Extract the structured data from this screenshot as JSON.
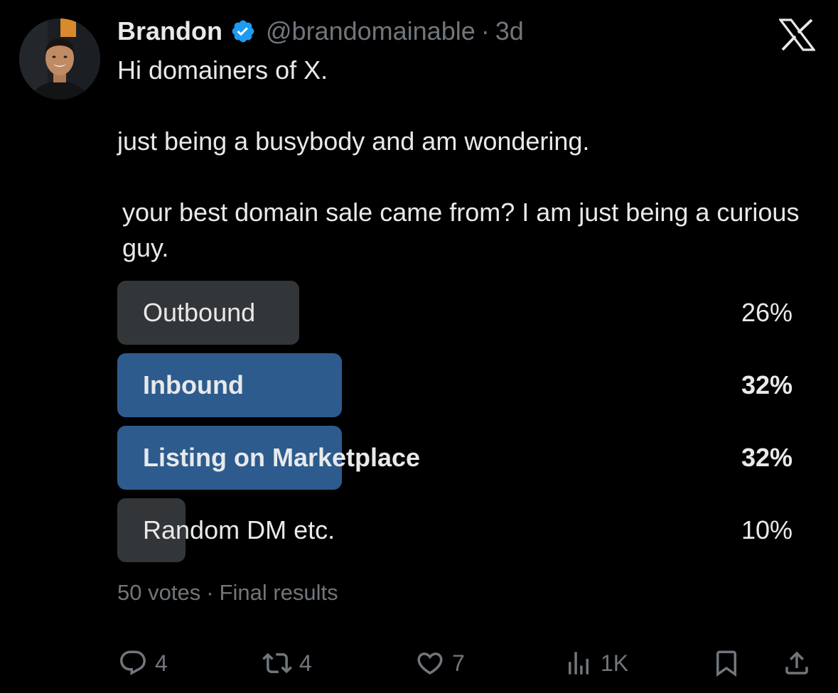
{
  "post": {
    "author": {
      "name": "Brandon",
      "handle": "@brandomainable",
      "verified": true,
      "verified_color": "#1d9bf0"
    },
    "separator": "·",
    "age": "3d",
    "text": {
      "line1": "Hi domainers of X.",
      "line2": "just being a busybody and am wondering.",
      "line3": "your best domain sale came from? I am just being a curious guy."
    }
  },
  "platform": {
    "logo": "x-logo"
  },
  "poll": {
    "options": [
      {
        "label": "Outbound",
        "percent_label": "26%",
        "percent": 26,
        "leading": false
      },
      {
        "label": "Inbound",
        "percent_label": "32%",
        "percent": 32,
        "leading": true
      },
      {
        "label": "Listing on Marketplace",
        "percent_label": "32%",
        "percent": 32,
        "leading": true
      },
      {
        "label": "Random DM etc.",
        "percent_label": "10%",
        "percent": 10,
        "leading": false
      }
    ],
    "votes": "50 votes",
    "separator": "·",
    "status": "Final results",
    "colors": {
      "leading_bar": "#2d5b8e",
      "other_bar": "#333639"
    }
  },
  "actions": {
    "reply": {
      "icon": "reply-icon",
      "count": "4"
    },
    "repost": {
      "icon": "repost-icon",
      "count": "4"
    },
    "like": {
      "icon": "heart-icon",
      "count": "7"
    },
    "views": {
      "icon": "views-icon",
      "count": "1K"
    },
    "bookmark": {
      "icon": "bookmark-icon"
    },
    "share": {
      "icon": "share-icon"
    }
  },
  "colors": {
    "background": "#000000",
    "text_primary": "#e7e9ea",
    "text_secondary": "#71767b"
  }
}
